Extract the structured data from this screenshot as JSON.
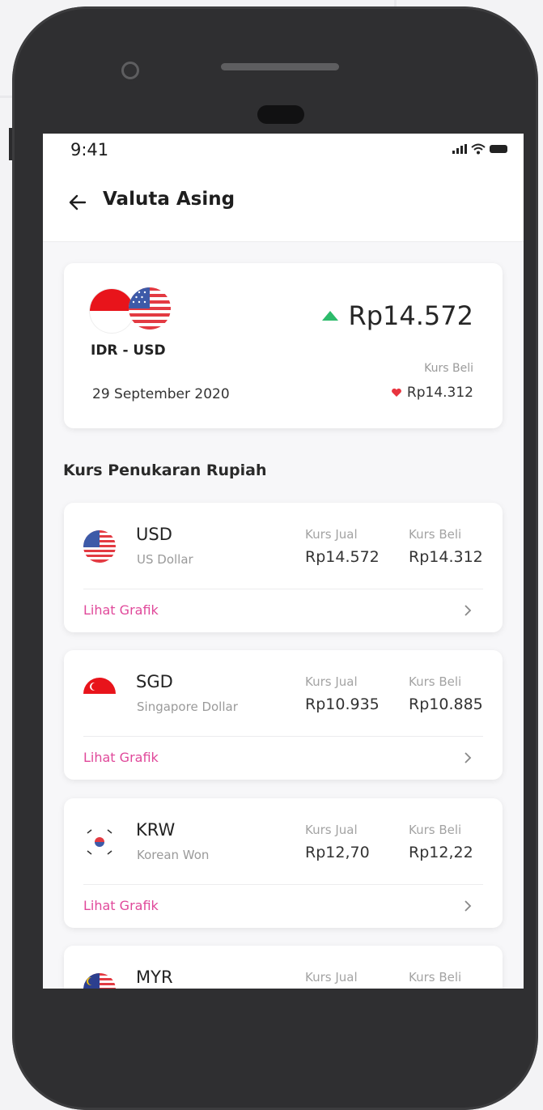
{
  "status": {
    "time": "9:41"
  },
  "header": {
    "title": "Valuta Asing"
  },
  "summary": {
    "pair": "IDR - USD",
    "date": "29 September 2020",
    "rate": "Rp14.572",
    "rate_trend": "up",
    "beli_label": "Kurs Beli",
    "beli_value": "Rp14.312",
    "beli_trend": "down"
  },
  "section_title": "Kurs Penukaran Rupiah",
  "rates": [
    {
      "code": "USD",
      "name": "US Dollar",
      "jual_label": "Kurs Jual",
      "jual": "Rp14.572",
      "beli_label": "Kurs Beli",
      "beli": "Rp14.312",
      "link": "Lihat Grafik",
      "flag": "us-flag-icon"
    },
    {
      "code": "SGD",
      "name": "Singapore Dollar",
      "jual_label": "Kurs Jual",
      "jual": "Rp10.935",
      "beli_label": "Kurs Beli",
      "beli": "Rp10.885",
      "link": "Lihat Grafik",
      "flag": "sg-flag-icon"
    },
    {
      "code": "KRW",
      "name": "Korean Won",
      "jual_label": "Kurs Jual",
      "jual": "Rp12,70",
      "beli_label": "Kurs Beli",
      "beli": "Rp12,22",
      "link": "Lihat Grafik",
      "flag": "kr-flag-icon"
    },
    {
      "code": "MYR",
      "jual_label": "Kurs Jual",
      "beli_label": "Kurs Beli",
      "flag": "my-flag-icon"
    }
  ],
  "colors": {
    "accent": "#e0489a",
    "up": "#2dbb6b",
    "down": "#e8343f",
    "flag_red": "#e8141b"
  }
}
